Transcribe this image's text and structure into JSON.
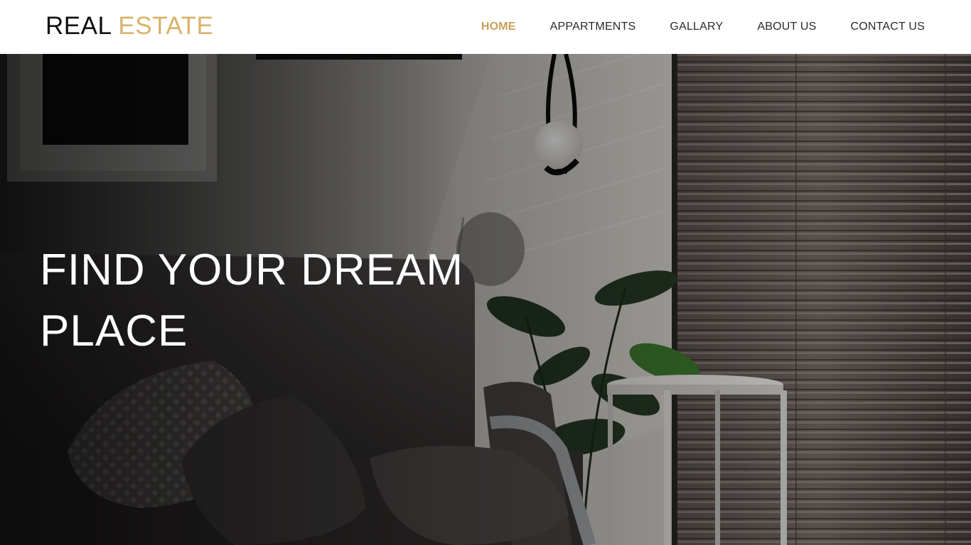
{
  "header": {
    "logo": {
      "word1": "REAL",
      "word2": "ESTATE"
    },
    "nav": [
      {
        "label": "HOME",
        "active": true
      },
      {
        "label": "APPARTMENTS",
        "active": false
      },
      {
        "label": "GALLARY",
        "active": false
      },
      {
        "label": "ABOUT US",
        "active": false
      },
      {
        "label": "CONTACT US",
        "active": false
      }
    ]
  },
  "hero": {
    "title_line1": "FIND YOUR DREAM",
    "title_line2": "PLACE"
  },
  "colors": {
    "accent": "#d9b36b",
    "nav_active": "#c9a05a",
    "header_bg": "#ffffff",
    "text_dark": "#111111",
    "hero_text": "#ffffff"
  }
}
